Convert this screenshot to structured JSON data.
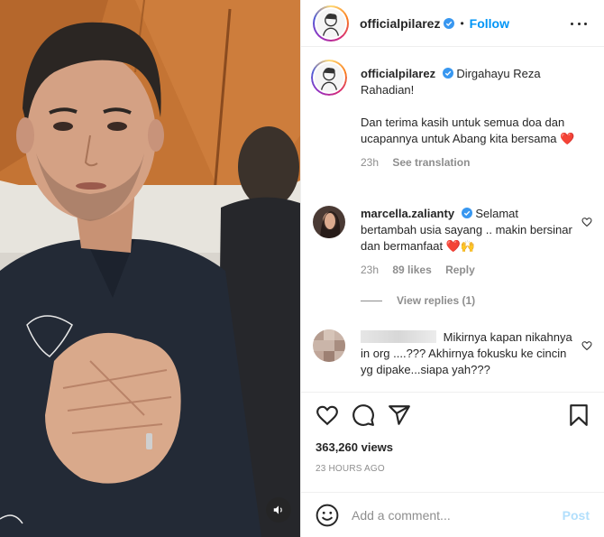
{
  "post": {
    "username": "officialpilarez",
    "follow_label": "Follow",
    "separator": "•",
    "views": "363,260 views",
    "timestamp": "23 HOURS AGO"
  },
  "caption": {
    "username": "officialpilarez",
    "line1": "Dirgahayu Reza Rahadian!",
    "line2": "Dan terima kasih untuk semua doa dan ucapannya untuk Abang kita bersama",
    "emoji": "❤️",
    "time": "23h",
    "see_translation": "See translation"
  },
  "comments": [
    {
      "username": "marcella.zalianty",
      "text": "Selamat bertambah usia sayang .. makin bersinar dan bermanfaat",
      "emoji": "❤️🙌",
      "time": "23h",
      "likes": "89 likes",
      "reply": "Reply",
      "view_replies": "View replies (1)"
    },
    {
      "username": "",
      "text": "Mikirnya kapan nikahnya in org ....??? Akhirnya fokusku ke cincin yg dipake...siapa yah???"
    }
  ],
  "add_comment": {
    "placeholder": "Add a comment...",
    "post_label": "Post"
  },
  "icons": {
    "like": "heart-icon",
    "comment": "comment-icon",
    "share": "paper-plane-icon",
    "save": "bookmark-icon",
    "more": "more-dots-icon",
    "verified": "verified-badge-icon",
    "emoji": "emoji-icon",
    "sound": "speaker-icon"
  },
  "colors": {
    "accent": "#0095f6",
    "post_disabled": "#b2dffc",
    "muted": "#8e8e8e",
    "heart": "#ed4956"
  }
}
